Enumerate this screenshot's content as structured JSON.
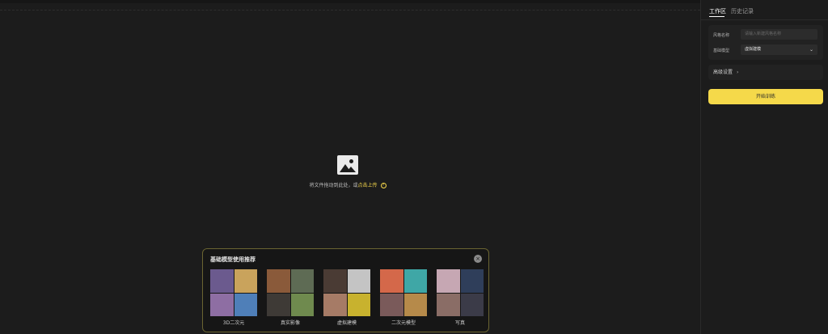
{
  "sidebar": {
    "tabs": [
      {
        "label": "工作区",
        "active": true
      },
      {
        "label": "历史记录",
        "active": false
      }
    ],
    "form": {
      "style_name_label": "风格名称",
      "style_name_placeholder": "请输入新建风格名称",
      "base_model_label": "基础模型",
      "base_model_value": "虚拟建模"
    },
    "advanced_label": "高级设置",
    "start_button": "开始训练"
  },
  "upload": {
    "text_prefix": "将文件拖动到此处，或",
    "link_text": "点击上传",
    "help_icon": "?"
  },
  "recommend": {
    "title": "基础模型使用推荐",
    "close_icon": "×",
    "items": [
      {
        "label": "3D二次元",
        "colors": [
          "#6b5a8e",
          "#c9a35c",
          "#8e6ea3",
          "#4f7fb8"
        ]
      },
      {
        "label": "真实影像",
        "colors": [
          "#8a5a3a",
          "#5e6b54",
          "#3e3a36",
          "#6f8a4e"
        ]
      },
      {
        "label": "虚拟建模",
        "colors": [
          "#4a3b34",
          "#c4c4c4",
          "#a67b66",
          "#c8b22e"
        ]
      },
      {
        "label": "二次元模型",
        "colors": [
          "#d4684a",
          "#3fa7a6",
          "#7a5a5a",
          "#b68a4a"
        ]
      },
      {
        "label": "写真",
        "colors": [
          "#c6a7b3",
          "#2f3e5a",
          "#8a6d66",
          "#3b3b48"
        ]
      }
    ]
  },
  "colors": {
    "accent": "#f5d94a",
    "background": "#1c1c1c",
    "panel": "#222222"
  }
}
